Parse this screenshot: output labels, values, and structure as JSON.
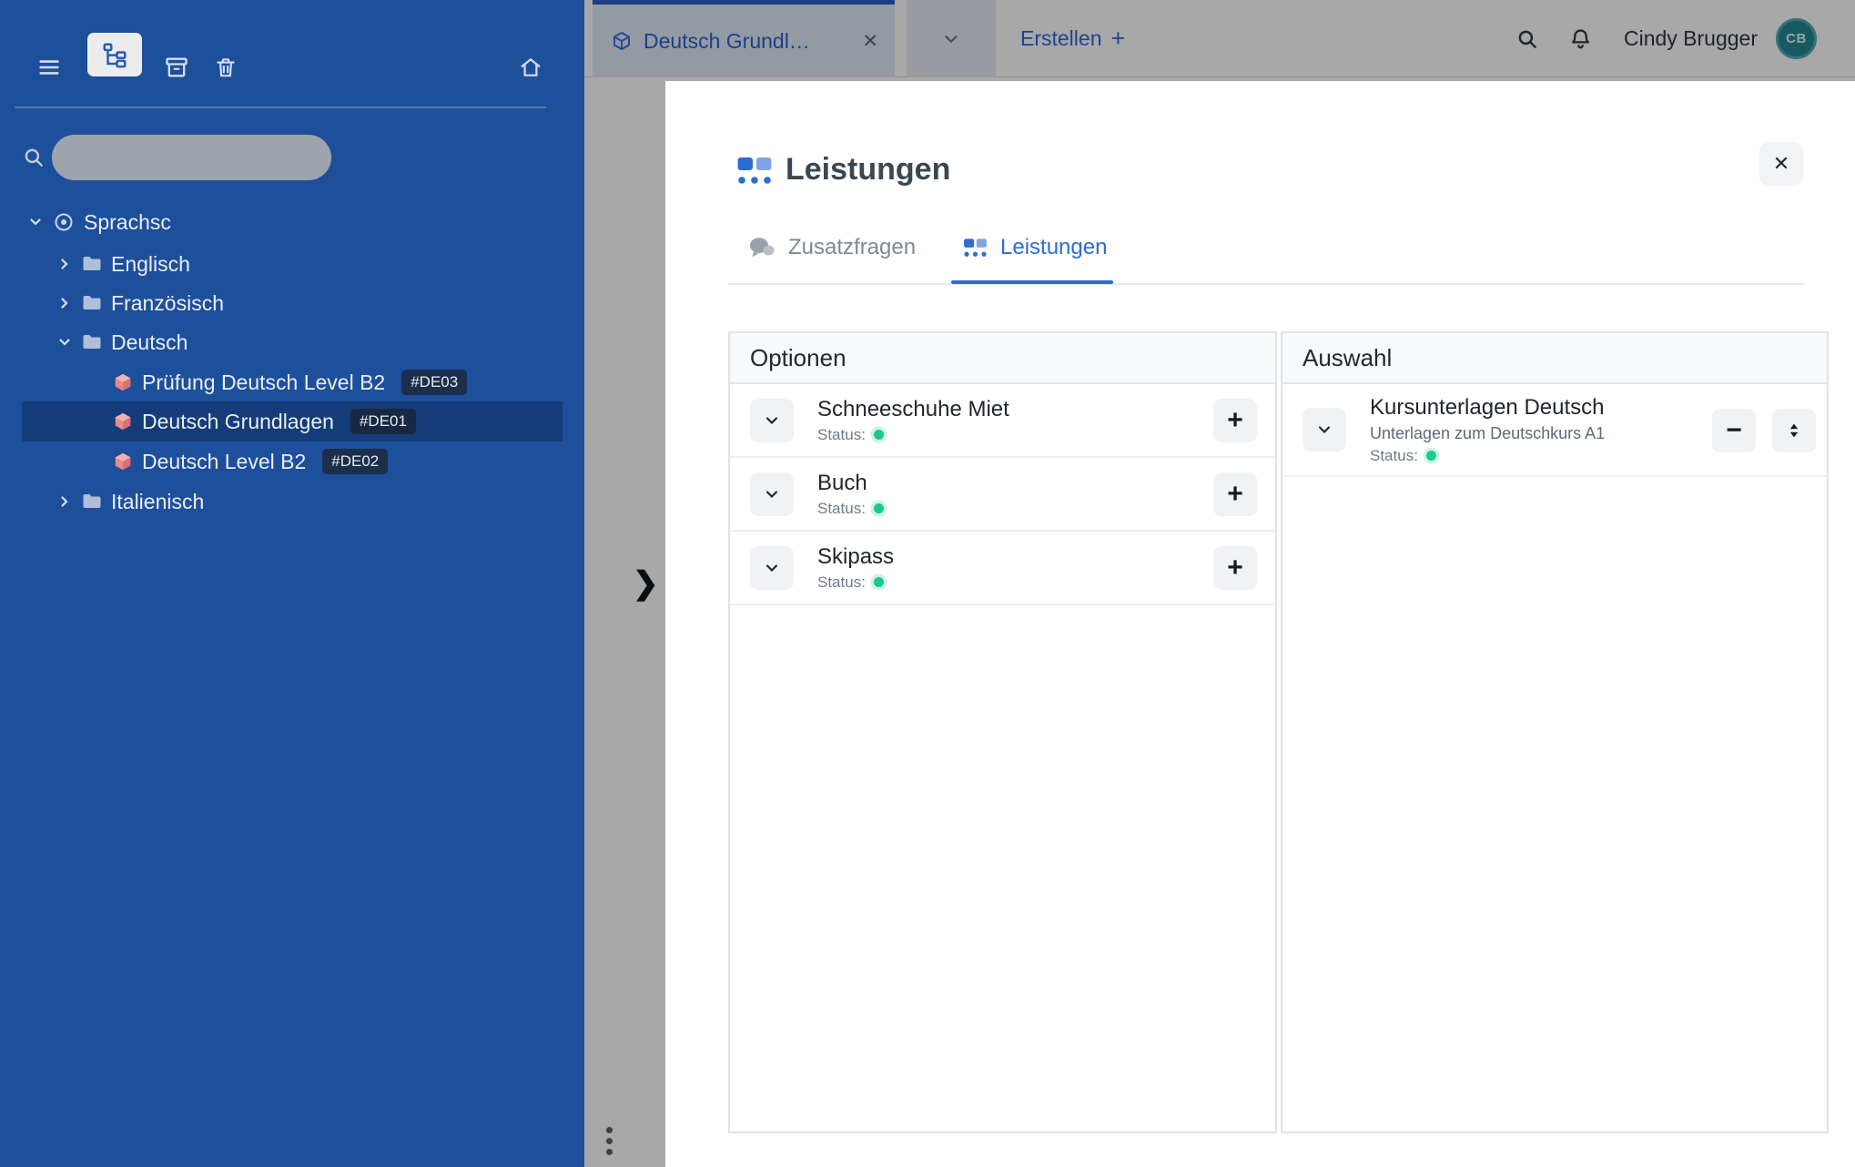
{
  "icons": {
    "close": "✕",
    "plus": "+",
    "minus": "−",
    "expand_handle": "❯"
  },
  "colors": {
    "sidebar_blue": "#1E4F9B",
    "sidebar_selected": "#143C79",
    "accent_blue": "#2E6BD3",
    "tab_blue": "#1D55C9",
    "status_green": "#1BC98E",
    "avatar_teal": "#177F8C"
  },
  "sidebar": {
    "search": {
      "placeholder": ""
    },
    "tree": [
      {
        "label": "Sprachsc"
      },
      {
        "label": "Englisch"
      },
      {
        "label": "Französisch"
      },
      {
        "label": "Deutsch"
      },
      {
        "label": "Prüfung Deutsch Level B2",
        "badge": "#DE03"
      },
      {
        "label": "Deutsch Grundlagen",
        "badge": "#DE01"
      },
      {
        "label": "Deutsch Level B2",
        "badge": "#DE02"
      },
      {
        "label": "Italienisch"
      }
    ]
  },
  "topbar": {
    "tab": {
      "label": "Deutsch Grundl…"
    },
    "create_label": "Erstellen",
    "user": {
      "name": "Cindy Brugger",
      "initials": "CB"
    }
  },
  "modal": {
    "title": "Leistungen",
    "tabs": [
      {
        "label": "Zusatzfragen"
      },
      {
        "label": "Leistungen"
      }
    ],
    "options_panel": {
      "title": "Optionen",
      "items": [
        {
          "title": "Schneeschuhe Miet",
          "status_label": "Status:"
        },
        {
          "title": "Buch",
          "status_label": "Status:"
        },
        {
          "title": "Skipass",
          "status_label": "Status:"
        }
      ]
    },
    "selection_panel": {
      "title": "Auswahl",
      "items": [
        {
          "title": "Kursunterlagen Deutsch",
          "subtitle": "Unterlagen zum Deutschkurs A1",
          "status_label": "Status:"
        }
      ]
    }
  }
}
